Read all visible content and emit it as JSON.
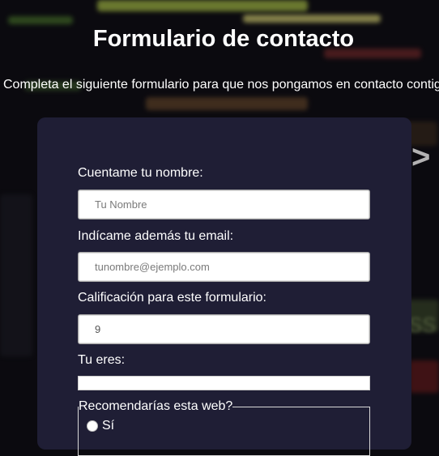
{
  "page": {
    "title": "Formulario de contacto",
    "subtitle": "Completa el siguiente formulario para que nos pongamos en contacto contigo"
  },
  "form": {
    "name_label": "Cuentame tu nombre:",
    "name_placeholder": "Tu Nombre",
    "email_label": "Indícame además tu email:",
    "email_placeholder": "tunombre@ejemplo.com",
    "rating_label": "Calificación para este formulario:",
    "rating_value": "9",
    "role_label": "Tu eres:",
    "recommend_legend": "Recomendarías esta web?",
    "recommend_options": [
      "Sí"
    ]
  },
  "colors": {
    "card": "#1f1e35",
    "text": "#ffffff"
  }
}
